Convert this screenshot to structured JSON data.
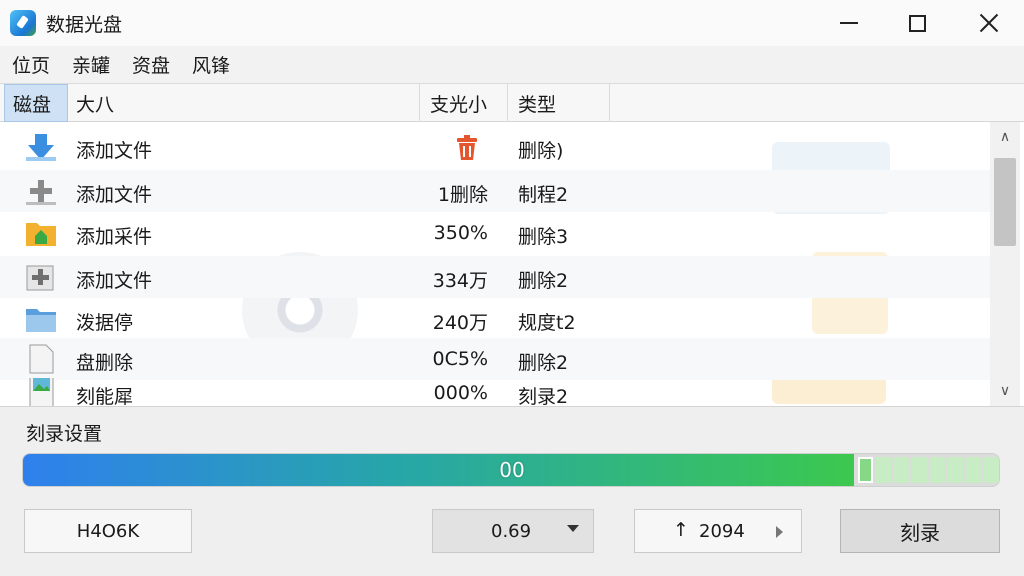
{
  "window": {
    "title": "数据光盘",
    "app_icon": "disc-burner-icon"
  },
  "menu": [
    "位页",
    "亲罐",
    "资盘",
    "风锋"
  ],
  "columns": {
    "disc": "磁盘",
    "size": "大八",
    "sub": "支光小",
    "type": "类型"
  },
  "rows": [
    {
      "icon": "download-arrow-icon",
      "name": "添加文件",
      "size": "",
      "size_icon": "trash-icon",
      "type": "删除)"
    },
    {
      "icon": "plus-icon",
      "name": "添加文件",
      "size": "1删除",
      "type": "制程2"
    },
    {
      "icon": "home-folder-icon",
      "name": "添加采件",
      "size": "350%",
      "type": "删除3"
    },
    {
      "icon": "add-file-icon",
      "name": "添加文件",
      "size": "334万",
      "type": "删除2"
    },
    {
      "icon": "folder-icon",
      "name": "泼据停",
      "size": "240万",
      "type": "规度t2"
    },
    {
      "icon": "image-file-icon",
      "name": "盘删除",
      "size": "0C5%",
      "type": "删除2"
    },
    {
      "icon": "image-file-icon",
      "name": "刻能犀",
      "size": "000%",
      "type": "刻录2"
    }
  ],
  "burn": {
    "section_label": "刻录设置",
    "progress_text": "00",
    "progress_fraction": 0.85,
    "progress_segments": 8,
    "left_field": "H4O6K",
    "speed_value": "0.69",
    "counter_value": "2094",
    "counter_up": "↑",
    "burn_button": "刻录"
  },
  "colors": {
    "accent_blue": "#2f80ed",
    "accent_green": "#3cc84f",
    "trash_orange": "#e4572e"
  }
}
